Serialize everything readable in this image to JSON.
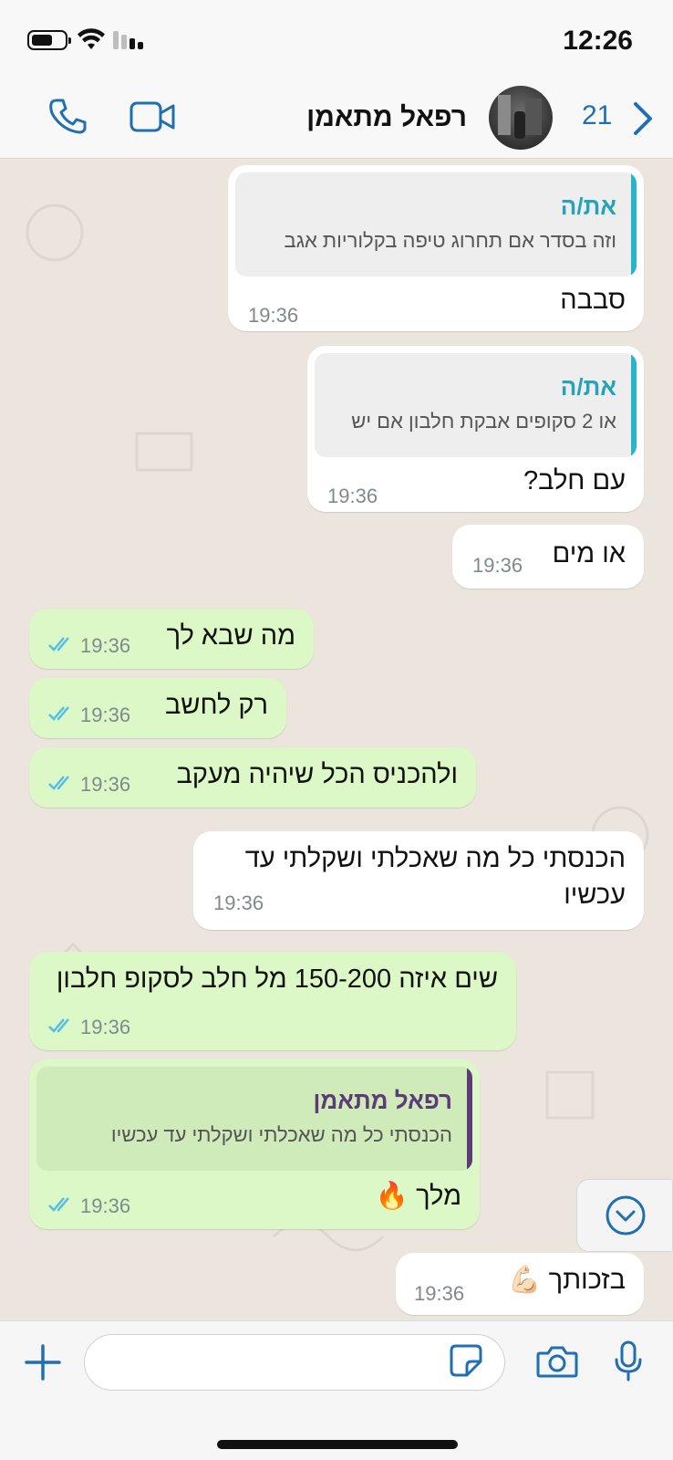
{
  "status_bar": {
    "time": "12:26"
  },
  "header": {
    "contact_name": "רפאל מתאמן",
    "unread_count": "21"
  },
  "messages": [
    {
      "type": "incoming",
      "quote_name": "את/ה",
      "quote_text": "וזה בסדר אם תחרוג טיפה בקלוריות אגב",
      "text": "סבבה",
      "time": "19:36"
    },
    {
      "type": "incoming",
      "quote_name": "את/ה",
      "quote_text": "או 2 סקופים אבקת חלבון אם יש",
      "text": "עם חלב?",
      "time": "19:36"
    },
    {
      "type": "incoming",
      "text": "או מים",
      "time": "19:36"
    },
    {
      "type": "outgoing",
      "text": "מה שבא לך",
      "time": "19:36"
    },
    {
      "type": "outgoing",
      "text": "רק לחשב",
      "time": "19:36"
    },
    {
      "type": "outgoing",
      "text": "ולהכניס הכל שיהיה מעקב",
      "time": "19:36"
    },
    {
      "type": "incoming",
      "text": "הכנסתי כל מה שאכלתי ושקלתי עד עכשיו",
      "time": "19:36"
    },
    {
      "type": "outgoing",
      "text": "שים איזה 150-200 מל חלב לסקופ חלבון",
      "time": "19:36"
    },
    {
      "type": "outgoing",
      "quote_name": "רפאל מתאמן",
      "quote_text": "הכנסתי כל מה שאכלתי ושקלתי עד עכשיו",
      "text": "מלך 🔥",
      "time": "19:36"
    },
    {
      "type": "incoming",
      "text": "בזכותך 💪🏻",
      "time": "19:36"
    }
  ],
  "input": {
    "placeholder": ""
  },
  "colors": {
    "accent": "#1f6fb2",
    "outgoing_bubble": "#dcf8c6",
    "incoming_bubble": "#ffffff",
    "chat_background": "#ece5dd",
    "read_ticks": "#53bdeb"
  },
  "icons": [
    "phone-icon",
    "video-icon",
    "chevron-right-icon",
    "scroll-down-icon",
    "plus-icon",
    "sticker-icon",
    "camera-icon",
    "mic-icon",
    "read-ticks-icon"
  ]
}
